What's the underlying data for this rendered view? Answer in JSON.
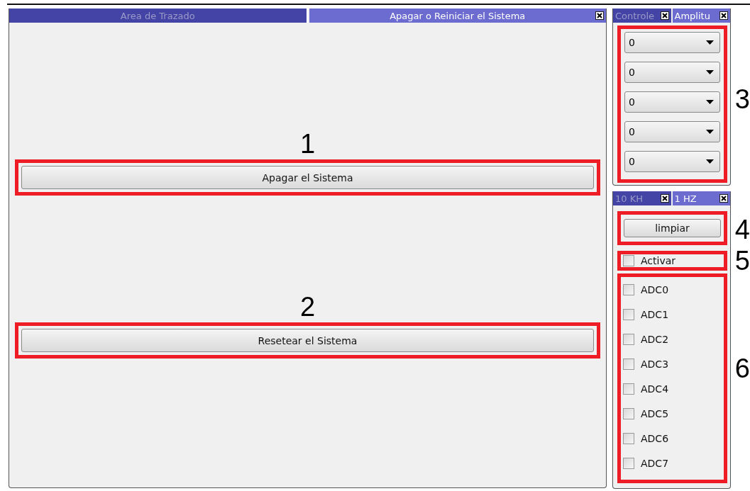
{
  "main_tabs": [
    {
      "label": "Area de Trazado",
      "selected": false,
      "closable": false
    },
    {
      "label": "Apagar o Reiniciar el Sistema",
      "selected": true,
      "closable": true
    }
  ],
  "main_actions": [
    {
      "callout": "1",
      "label": "Apagar el Sistema"
    },
    {
      "callout": "2",
      "label": "Resetear el Sistema"
    }
  ],
  "controls_panel": {
    "tabs": [
      {
        "label": "Controle",
        "selected": false,
        "closable": true
      },
      {
        "label": "Amplitu",
        "selected": true,
        "closable": true
      }
    ],
    "callout": "3",
    "dropdowns": [
      "0",
      "0",
      "0",
      "0",
      "0"
    ]
  },
  "acquisition_panel": {
    "tabs": [
      {
        "label": "10 KH",
        "selected": false,
        "closable": true
      },
      {
        "label": "1 HZ",
        "selected": true,
        "closable": true
      }
    ],
    "clear_button": {
      "callout": "4",
      "label": "limpiar"
    },
    "enable": {
      "callout": "5",
      "label": "Activar",
      "checked": false
    },
    "channels_callout": "6",
    "channels": [
      {
        "label": "ADC0",
        "checked": false
      },
      {
        "label": "ADC1",
        "checked": false
      },
      {
        "label": "ADC2",
        "checked": false
      },
      {
        "label": "ADC3",
        "checked": false
      },
      {
        "label": "ADC4",
        "checked": false
      },
      {
        "label": "ADC5",
        "checked": false
      },
      {
        "label": "ADC6",
        "checked": false
      },
      {
        "label": "ADC7",
        "checked": false
      }
    ]
  }
}
